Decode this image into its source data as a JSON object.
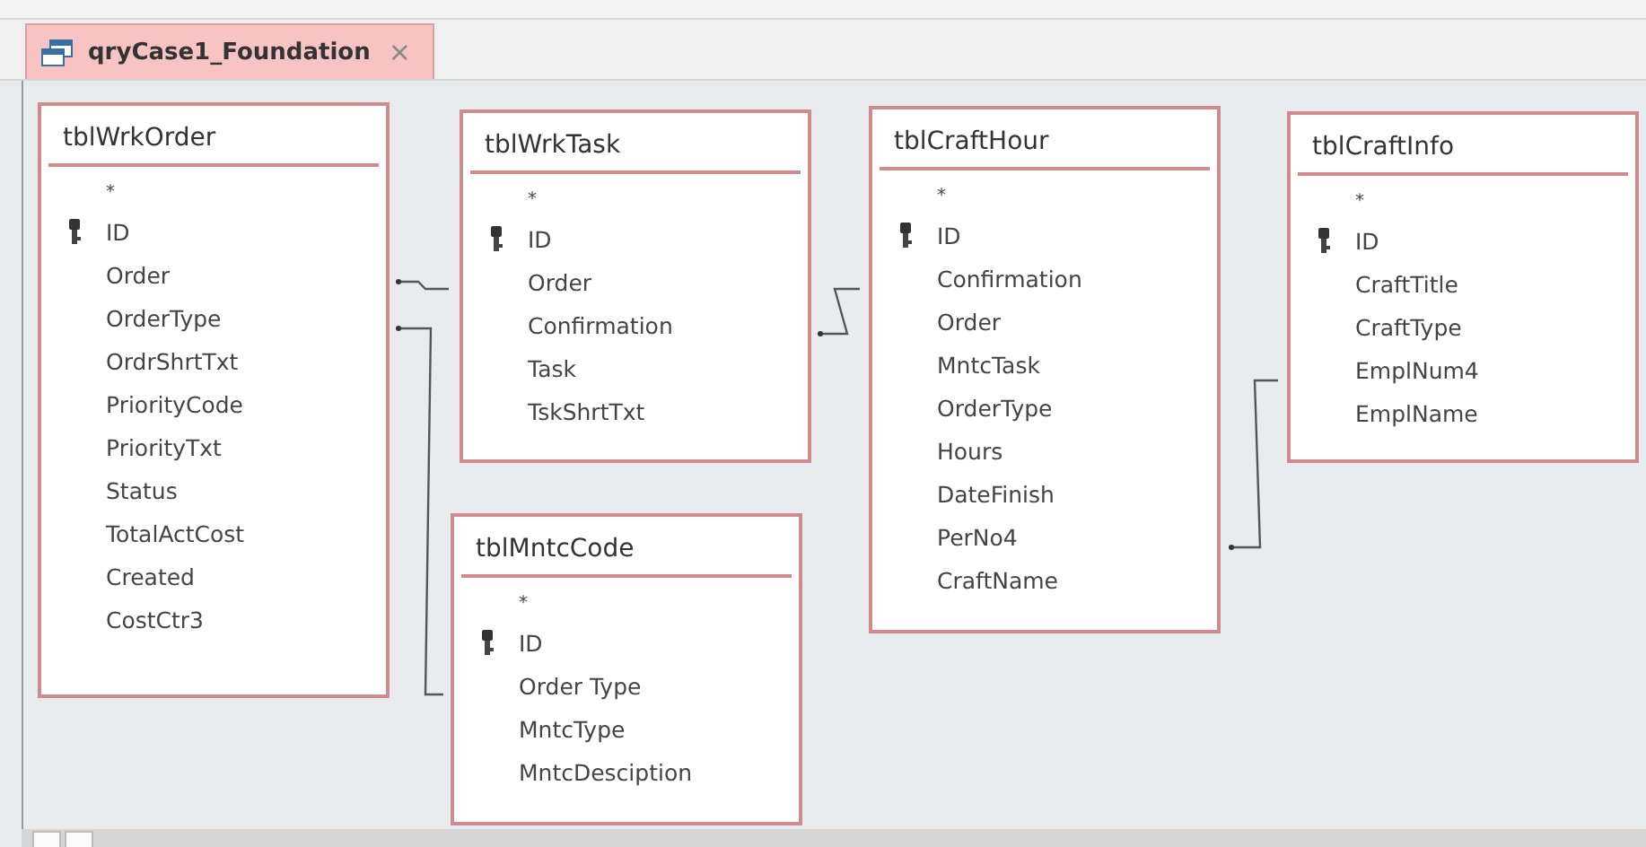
{
  "document_tab": {
    "title": "qryCase1_Foundation",
    "close": "×",
    "selected": true
  },
  "tables": [
    {
      "name": "tblWrkOrder",
      "fields": [
        {
          "name": "*",
          "primary_key": false
        },
        {
          "name": "ID",
          "primary_key": true
        },
        {
          "name": "Order",
          "primary_key": false
        },
        {
          "name": "OrderType",
          "primary_key": false
        },
        {
          "name": "OrdrShrtTxt",
          "primary_key": false
        },
        {
          "name": "PriorityCode",
          "primary_key": false
        },
        {
          "name": "PriorityTxt",
          "primary_key": false
        },
        {
          "name": "Status",
          "primary_key": false
        },
        {
          "name": "TotalActCost",
          "primary_key": false
        },
        {
          "name": "Created",
          "primary_key": false
        },
        {
          "name": "CostCtr3",
          "primary_key": false
        }
      ]
    },
    {
      "name": "tblWrkTask",
      "fields": [
        {
          "name": "*",
          "primary_key": false
        },
        {
          "name": "ID",
          "primary_key": true
        },
        {
          "name": "Order",
          "primary_key": false
        },
        {
          "name": "Confirmation",
          "primary_key": false
        },
        {
          "name": "Task",
          "primary_key": false
        },
        {
          "name": "TskShrtTxt",
          "primary_key": false
        }
      ]
    },
    {
      "name": "tblMntcCode",
      "fields": [
        {
          "name": "*",
          "primary_key": false
        },
        {
          "name": "ID",
          "primary_key": true
        },
        {
          "name": "Order Type",
          "primary_key": false
        },
        {
          "name": "MntcType",
          "primary_key": false
        },
        {
          "name": "MntcDesciption",
          "primary_key": false
        }
      ]
    },
    {
      "name": "tblCraftHour",
      "fields": [
        {
          "name": "*",
          "primary_key": false
        },
        {
          "name": "ID",
          "primary_key": true
        },
        {
          "name": "Confirmation",
          "primary_key": false
        },
        {
          "name": "Order",
          "primary_key": false
        },
        {
          "name": "MntcTask",
          "primary_key": false
        },
        {
          "name": "OrderType",
          "primary_key": false
        },
        {
          "name": "Hours",
          "primary_key": false
        },
        {
          "name": "DateFinish",
          "primary_key": false
        },
        {
          "name": "PerNo4",
          "primary_key": false
        },
        {
          "name": "CraftName",
          "primary_key": false
        }
      ]
    },
    {
      "name": "tblCraftInfo",
      "fields": [
        {
          "name": "*",
          "primary_key": false
        },
        {
          "name": "ID",
          "primary_key": true
        },
        {
          "name": "CraftTitle",
          "primary_key": false
        },
        {
          "name": "CraftType",
          "primary_key": false
        },
        {
          "name": "EmplNum4",
          "primary_key": false
        },
        {
          "name": "EmplName",
          "primary_key": false
        }
      ]
    }
  ]
}
